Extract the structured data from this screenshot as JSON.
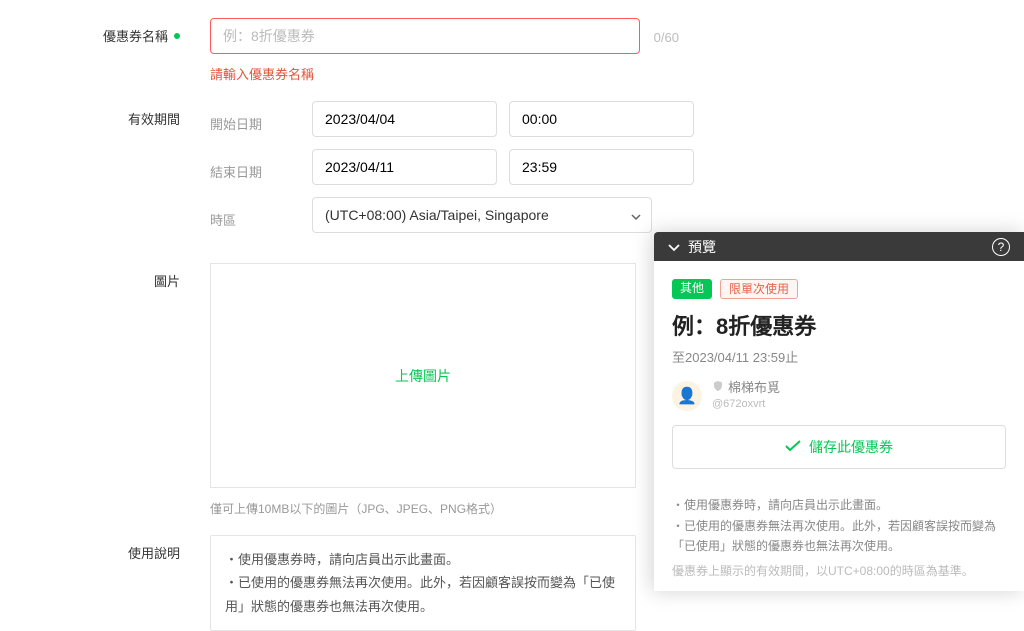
{
  "form": {
    "name_label": "優惠券名稱",
    "name_placeholder": "例：8折優惠券",
    "name_counter": "0/60",
    "name_error": "請輸入優惠券名稱",
    "valid_label": "有效期間",
    "start_label": "開始日期",
    "start_date": "2023/04/04",
    "start_time": "00:00",
    "end_label": "結束日期",
    "end_date": "2023/04/11",
    "end_time": "23:59",
    "tz_label": "時區",
    "tz_value": "(UTC+08:00) Asia/Taipei, Singapore",
    "image_label": "圖片",
    "upload_text": "上傳圖片",
    "upload_hint": "僅可上傳10MB以下的圖片（JPG、JPEG、PNG格式）",
    "desc_label": "使用說明",
    "desc_line1": "・使用優惠券時，請向店員出示此畫面。",
    "desc_line2": "・已使用的優惠券無法再次使用。此外，若因顧客誤按而變為「已使用」狀態的優惠券也無法再次使用。"
  },
  "preview": {
    "header": "預覽",
    "tag1": "其他",
    "tag2": "限單次使用",
    "title": "例：8折優惠券",
    "valid_until": "至2023/04/11 23:59止",
    "store_name": "棉梯布覓",
    "store_handle": "@672oxvrt",
    "save_label": "儲存此優惠券",
    "note1": "・使用優惠券時，請向店員出示此畫面。",
    "note2": "・已使用的優惠券無法再次使用。此外，若因顧客誤按而變為「已使用」狀態的優惠券也無法再次使用。",
    "tz_note": "優惠券上顯示的有效期間，以UTC+08:00的時區為基準。"
  }
}
